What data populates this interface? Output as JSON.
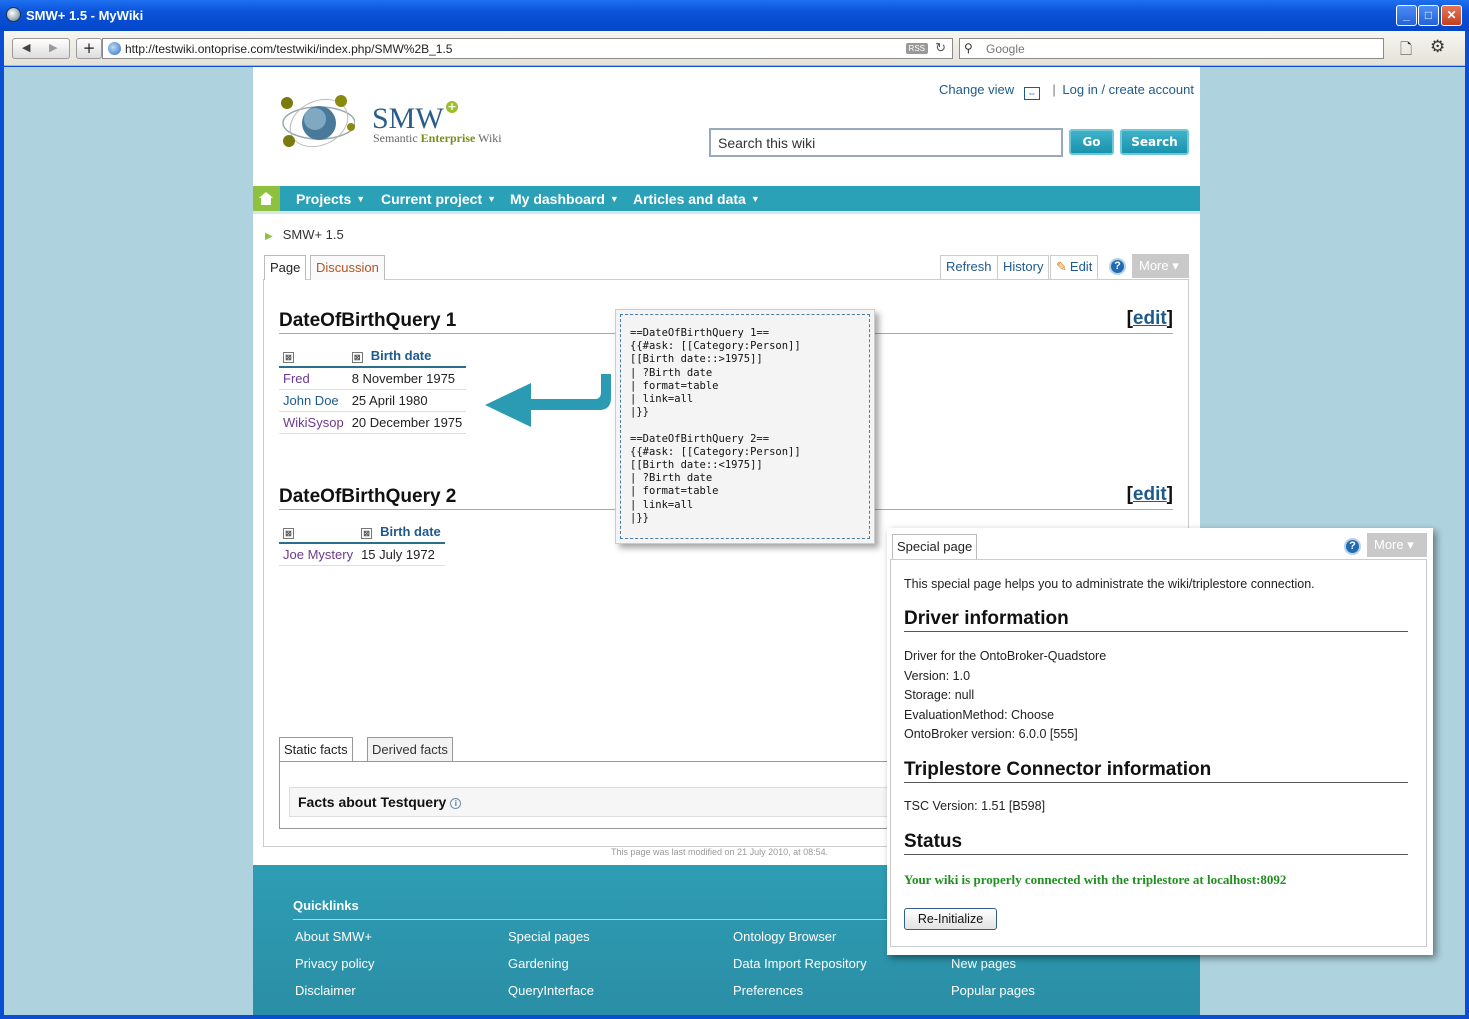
{
  "window": {
    "title": "SMW+ 1.5 - MyWiki",
    "controls": {
      "minimize": "_",
      "maximize": "□",
      "close": "✕"
    }
  },
  "browser": {
    "back": "◀",
    "forward": "▶",
    "new_tab": "+",
    "url": "http://testwiki.ontoprise.com/testwiki/index.php/SMW%2B_1.5",
    "rss": "RSS",
    "reload": "↻",
    "search_placeholder": "Google",
    "search_icon": "⚲",
    "page_icon": "🗋",
    "tools_icon": "⚙"
  },
  "logo": {
    "title": "SMW",
    "plus": "+",
    "subtitle_a": "Semantic ",
    "subtitle_b": "Enterprise",
    "subtitle_c": " Wiki"
  },
  "userlinks": {
    "change_view": "Change view",
    "change_view_icon": "⇔",
    "separator": "|",
    "login": "Log in / create account"
  },
  "search": {
    "placeholder": "Search this wiki",
    "go": "Go",
    "search": "Search"
  },
  "menu": {
    "caret": "▼",
    "items": [
      {
        "label": "Projects"
      },
      {
        "label": "Current project"
      },
      {
        "label": "My dashboard"
      },
      {
        "label": "Articles and data"
      }
    ]
  },
  "breadcrumb": {
    "marker": "▶",
    "label": "SMW+ 1.5"
  },
  "page_tabs": {
    "page": "Page",
    "discussion": "Discussion"
  },
  "actions": {
    "refresh": "Refresh",
    "history": "History",
    "edit_icon": "✎",
    "edit": "Edit",
    "help": "?",
    "more": "More",
    "more_caret": "▾"
  },
  "sections": [
    {
      "title": "DateOfBirthQuery 1",
      "edit_open": "[",
      "edit": "edit",
      "edit_close": "]",
      "sort_icon": "⊠",
      "column": "Birth date",
      "rows": [
        {
          "name": "Fred",
          "date": "8 November 1975"
        },
        {
          "name": "John Doe",
          "date": "25 April 1980"
        },
        {
          "name": "WikiSysop",
          "date": "20 December 1975"
        }
      ]
    },
    {
      "title": "DateOfBirthQuery 2",
      "edit_open": "[",
      "edit": "edit",
      "edit_close": "]",
      "sort_icon": "⊠",
      "column": "Birth date",
      "rows": [
        {
          "name": "Joe Mystery",
          "date": "15 July 1972"
        }
      ]
    }
  ],
  "code_popup": "==DateOfBirthQuery 1==\n{{#ask: [[Category:Person]]\n[[Birth date::>1975]]\n| ?Birth date\n| format=table\n| link=all\n|}}\n\n==DateOfBirthQuery 2==\n{{#ask: [[Category:Person]]\n[[Birth date::<1975]]\n| ?Birth date\n| format=table\n| link=all\n|}}",
  "facts": {
    "tab_static": "Static facts",
    "tab_derived": "Derived facts",
    "heading": "Facts about Testquery",
    "info_icon": "i"
  },
  "last_modified": "This page was last modified on 21 July 2010, at 08:54.",
  "footer": {
    "heading": "Quicklinks",
    "col1": [
      "About SMW+",
      "Privacy policy",
      "Disclaimer"
    ],
    "col2": [
      "Special pages",
      "Gardening",
      "QueryInterface"
    ],
    "col3": [
      "Ontology Browser",
      "Data Import Repository",
      "Preferences"
    ],
    "col4": [
      "New pages",
      "Popular pages"
    ]
  },
  "special_page": {
    "tab": "Special page",
    "help": "?",
    "more": "More",
    "more_caret": "▾",
    "intro": "This special page helps you to administrate the wiki/triplestore connection.",
    "driver_heading": "Driver information",
    "driver_lines": [
      "Driver for the OntoBroker-Quadstore",
      "Version: 1.0",
      "Storage: null",
      "EvaluationMethod: Choose",
      "OntoBroker version: 6.0.0 [555]"
    ],
    "tsc_heading": "Triplestore Connector information",
    "tsc_line": "TSC Version: 1.51 [B598]",
    "status_heading": "Status",
    "status_message": "Your wiki is properly connected with the triplestore at localhost:8092",
    "reinit": "Re-Initialize"
  },
  "colors": {
    "teal": "#2ba1b8",
    "green": "#8ec13e",
    "link": "#1e5a8c",
    "ok": "#1f8f1f"
  }
}
